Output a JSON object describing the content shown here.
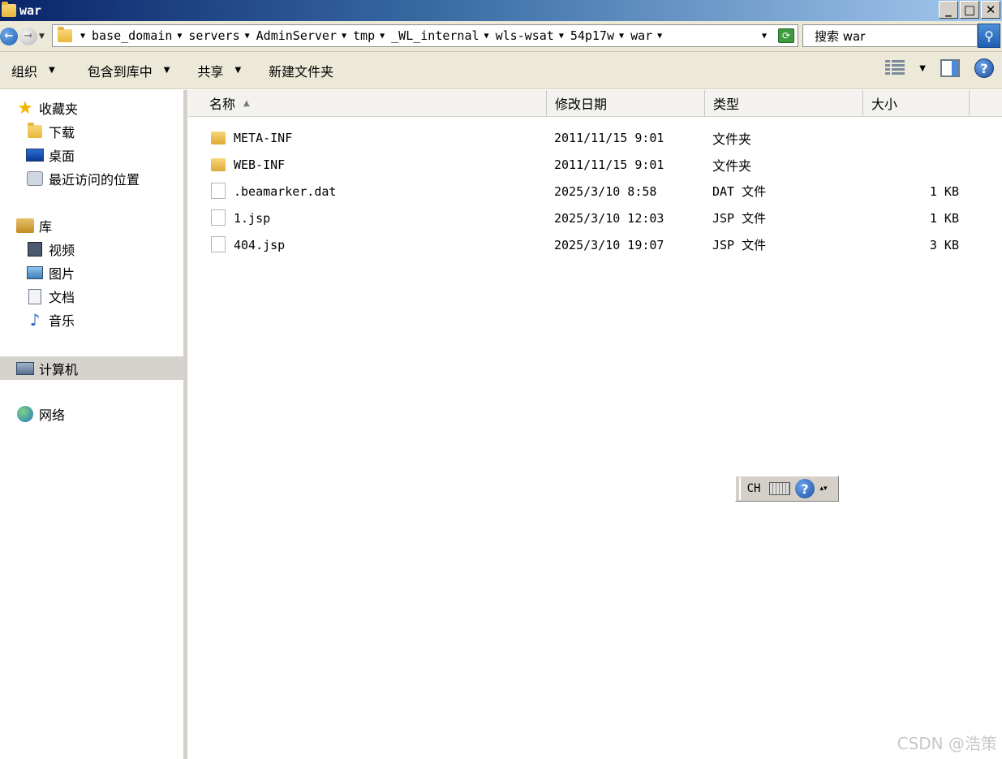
{
  "window": {
    "title": "war",
    "controls": {
      "minimize": "_",
      "maximize": "□",
      "close": "✕"
    }
  },
  "address": {
    "breadcrumbs": [
      "base_domain",
      "servers",
      "AdminServer",
      "tmp",
      "_WL_internal",
      "wls-wsat",
      "54p17w",
      "war"
    ],
    "search_placeholder": "搜索 war"
  },
  "toolbar": {
    "organize": "组织",
    "include_library": "包含到库中",
    "share": "共享",
    "new_folder": "新建文件夹"
  },
  "sidebar": {
    "favorites": "收藏夹",
    "downloads": "下载",
    "desktop": "桌面",
    "recent": "最近访问的位置",
    "libraries": "库",
    "videos": "视频",
    "pictures": "图片",
    "documents": "文档",
    "music": "音乐",
    "computer": "计算机",
    "network": "网络"
  },
  "columns": {
    "name": "名称",
    "date": "修改日期",
    "type": "类型",
    "size": "大小"
  },
  "files": [
    {
      "name": "META-INF",
      "date": "2011/11/15 9:01",
      "type": "文件夹",
      "size": "",
      "kind": "folder"
    },
    {
      "name": "WEB-INF",
      "date": "2011/11/15 9:01",
      "type": "文件夹",
      "size": "",
      "kind": "folder"
    },
    {
      "name": ".beamarker.dat",
      "date": "2025/3/10 8:58",
      "type": "DAT 文件",
      "size": "1 KB",
      "kind": "file"
    },
    {
      "name": "1.jsp",
      "date": "2025/3/10 12:03",
      "type": "JSP 文件",
      "size": "1 KB",
      "kind": "file"
    },
    {
      "name": "404.jsp",
      "date": "2025/3/10 19:07",
      "type": "JSP 文件",
      "size": "3 KB",
      "kind": "file"
    }
  ],
  "langbar": {
    "lang": "CH",
    "help": "?"
  },
  "watermark": "CSDN @浩策"
}
